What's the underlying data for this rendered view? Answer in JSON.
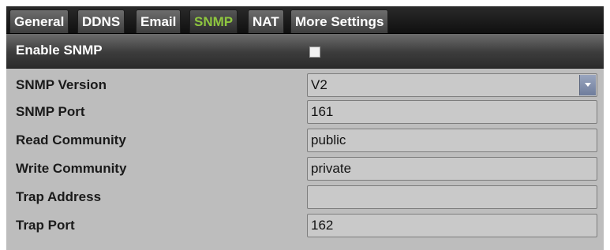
{
  "tabs": [
    {
      "label": "General"
    },
    {
      "label": "DDNS"
    },
    {
      "label": "Email"
    },
    {
      "label": "SNMP",
      "active": true
    },
    {
      "label": "NAT"
    },
    {
      "label": "More Settings"
    }
  ],
  "enable": {
    "label": "Enable SNMP",
    "checked": false
  },
  "form": {
    "snmp_version": {
      "label": "SNMP Version",
      "value": "V2"
    },
    "snmp_port": {
      "label": "SNMP Port",
      "value": "161"
    },
    "read_community": {
      "label": "Read Community",
      "value": "public"
    },
    "write_community": {
      "label": "Write Community",
      "value": "private"
    },
    "trap_address": {
      "label": "Trap Address",
      "value": ""
    },
    "trap_port": {
      "label": "Trap Port",
      "value": "162"
    }
  },
  "colors": {
    "active_tab": "#8ec63f",
    "panel_bg": "#bdbdbd",
    "dropdown_button": "#7f8cab"
  },
  "icons": {
    "dropdown": "chevron-down-icon",
    "checkbox": "checkbox-unchecked"
  }
}
